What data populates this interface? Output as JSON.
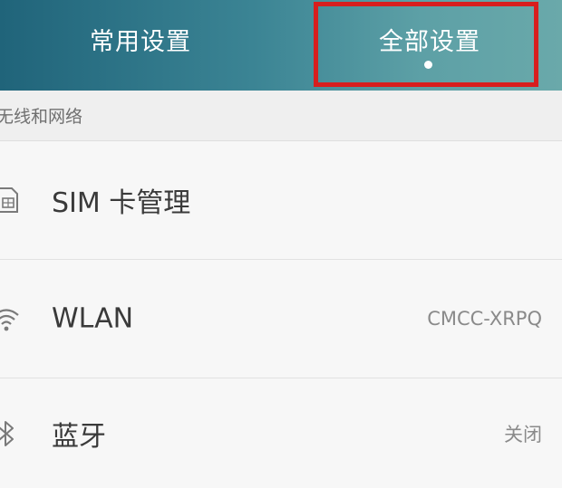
{
  "tabs": {
    "common": {
      "label": "常用设置"
    },
    "all": {
      "label": "全部设置"
    }
  },
  "section": {
    "title": "无线和网络"
  },
  "items": [
    {
      "title": "SIM 卡管理",
      "value": "",
      "icon": "sim-card-icon"
    },
    {
      "title": "WLAN",
      "value": "CMCC-XRPQ",
      "icon": "wifi-icon"
    },
    {
      "title": "蓝牙",
      "value": "关闭",
      "icon": "bluetooth-icon"
    }
  ],
  "colors": {
    "tabbar_start": "#20647a",
    "tabbar_end": "#6aa9aa",
    "highlight": "#d81e1e"
  }
}
